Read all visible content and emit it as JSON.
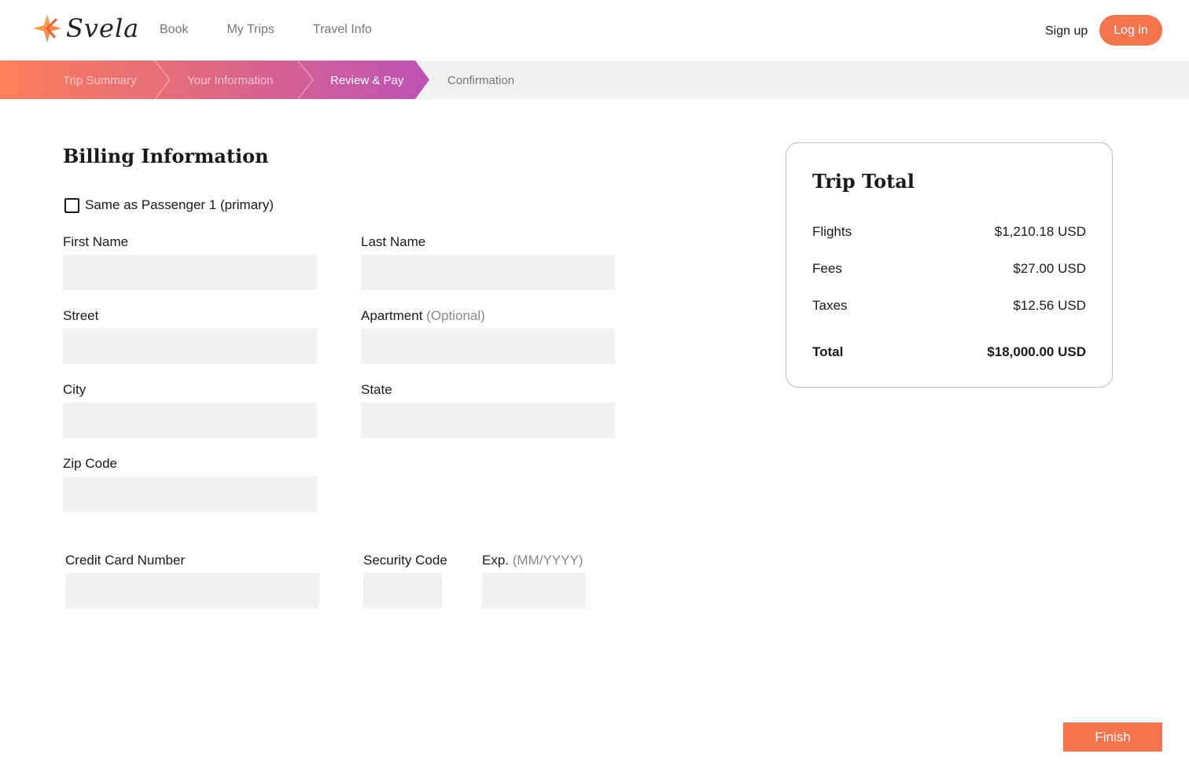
{
  "brand": {
    "name": "Svela",
    "accent": "#f4744e"
  },
  "nav": {
    "items": [
      "Book",
      "My Trips",
      "Travel Info"
    ]
  },
  "auth": {
    "signup_label": "Sign up",
    "login_label": "Log in"
  },
  "steps": [
    "Trip Summary",
    "Your Information",
    "Review & Pay",
    "Confirmation"
  ],
  "billing": {
    "title": "Billing Information",
    "same_as_label": "Same as Passenger 1 (primary)",
    "first_name_label": "First Name",
    "last_name_label": "Last Name",
    "street_label": "Street",
    "apartment_label": "Apartment",
    "optional_tag": "(Optional)",
    "city_label": "City",
    "state_label": "State",
    "zip_label": "Zip Code",
    "card_number_label": "Credit Card Number",
    "security_label": "Security Code",
    "exp_label": "Exp.",
    "exp_format": "(MM/YYYY)"
  },
  "trip_total": {
    "title": "Trip Total",
    "lines": [
      {
        "label": "Flights",
        "value": "$1,210.18 USD"
      },
      {
        "label": "Fees",
        "value": "$27.00 USD"
      },
      {
        "label": "Taxes",
        "value": "$12.56 USD"
      }
    ],
    "total": {
      "label": "Total",
      "value": "$18,000.00 USD"
    }
  },
  "actions": {
    "finish_label": "Finish"
  }
}
